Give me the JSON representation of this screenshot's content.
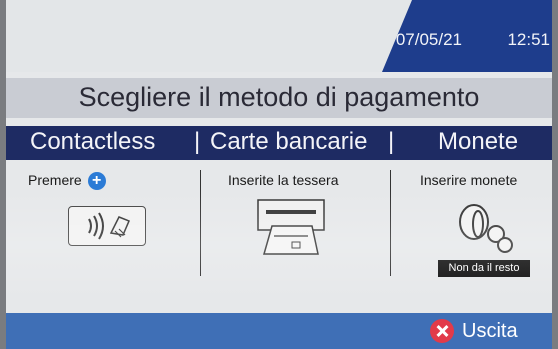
{
  "status": {
    "date": "07/05/21",
    "time": "12:51"
  },
  "title": "Scegliere il metodo di pagamento",
  "methods": [
    {
      "label": "Contactless",
      "instruction": "Premere",
      "icon": "nfc-card-icon"
    },
    {
      "label": "Carte bancarie",
      "instruction": "Inserite la tessera",
      "icon": "card-slot-icon"
    },
    {
      "label": "Monete",
      "instruction": "Inserire monete",
      "icon": "coins-icon",
      "note": "Non da il resto"
    }
  ],
  "separator": "|",
  "footer": {
    "exit_label": "Uscita"
  },
  "colors": {
    "header_blue": "#1e3d8c",
    "band_navy": "#1e2b63",
    "footer_blue": "#3f6fb6",
    "exit_red": "#e23a4a"
  }
}
